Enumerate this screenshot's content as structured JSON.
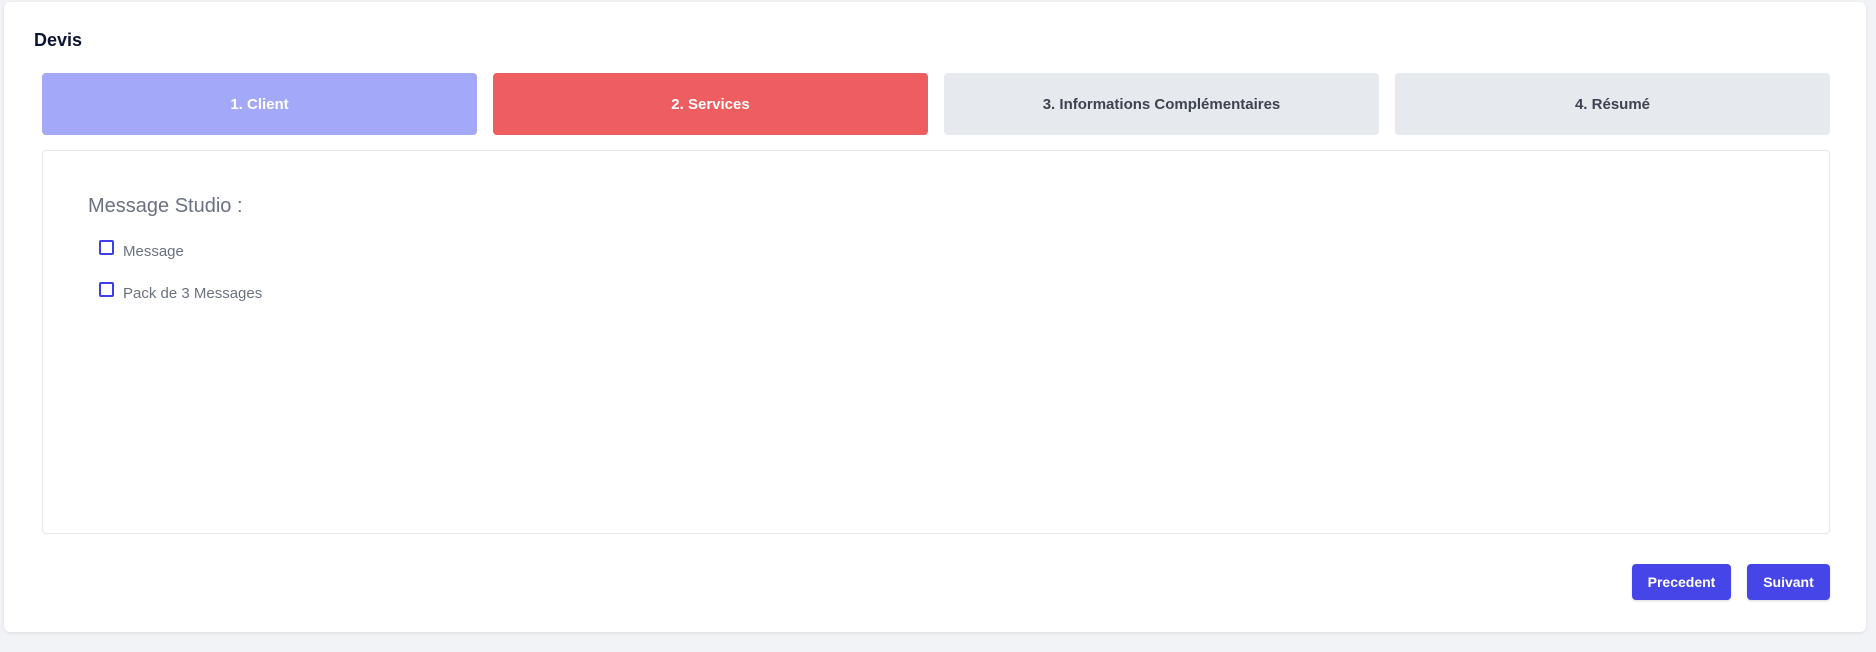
{
  "card": {
    "title": "Devis"
  },
  "steps": [
    {
      "label": "1. Client",
      "state": "done"
    },
    {
      "label": "2. Services",
      "state": "active"
    },
    {
      "label": "3. Informations Complémentaires",
      "state": "todo"
    },
    {
      "label": "4. Résumé",
      "state": "todo"
    }
  ],
  "services": {
    "section_title": "Message Studio :",
    "options": [
      {
        "label": "Message",
        "checked": false
      },
      {
        "label": "Pack de 3 Messages",
        "checked": false
      }
    ]
  },
  "actions": {
    "prev_label": "Precedent",
    "next_label": "Suivant"
  },
  "colors": {
    "step_done": "#a3a8f8",
    "step_active": "#ee5d5f",
    "step_todo": "#e6e9ee",
    "primary": "#4646e8"
  }
}
